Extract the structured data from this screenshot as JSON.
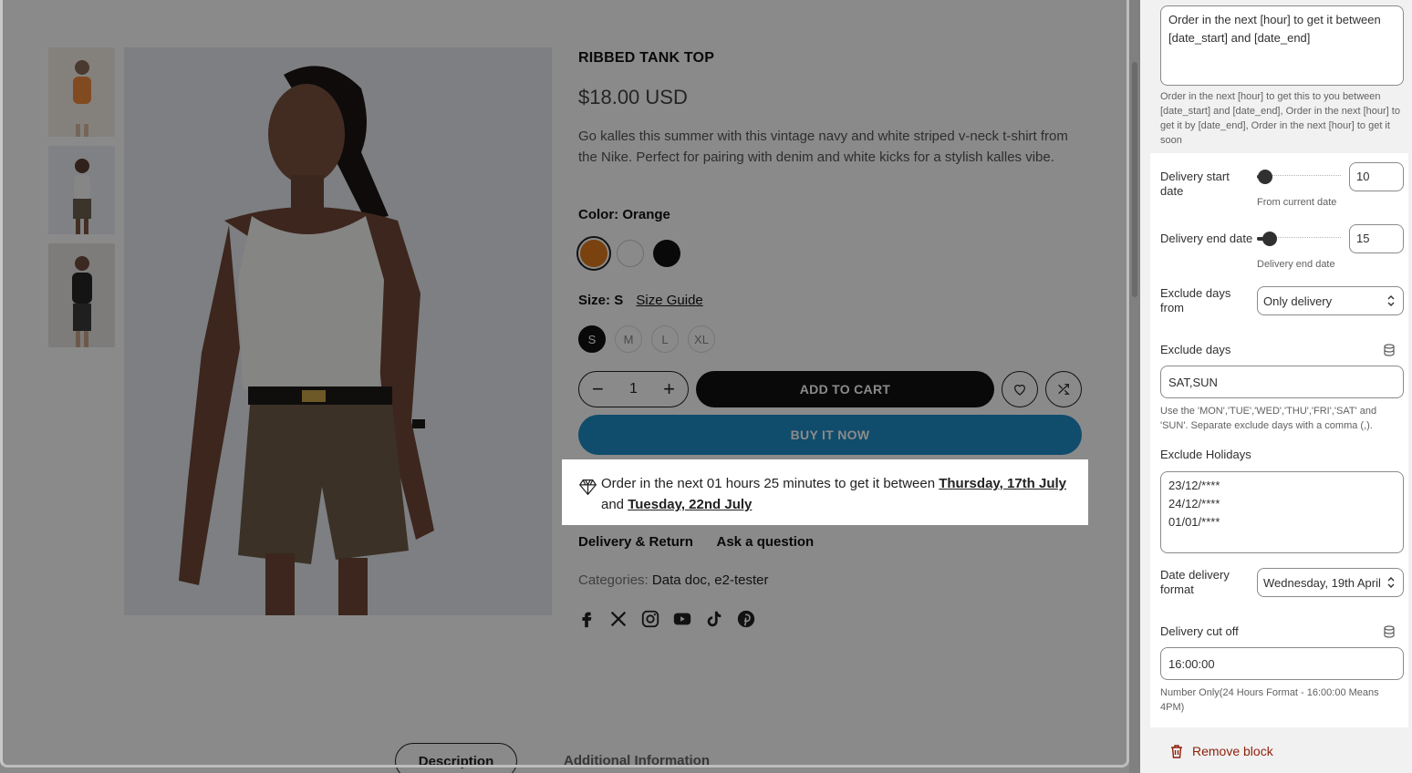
{
  "product": {
    "title": "RIBBED TANK TOP",
    "price": "$18.00 USD",
    "description": "Go kalles this summer with this vintage navy and white striped v-neck t-shirt from the Nike. Perfect for pairing with denim and white kicks for a stylish kalles vibe.",
    "color_label": "Color:",
    "color_value": "Orange",
    "colors": [
      "#e07b1c",
      "#ffffff",
      "#111111"
    ],
    "size_label": "Size:",
    "size_value": "S",
    "size_guide": "Size Guide",
    "sizes": [
      "S",
      "M",
      "L",
      "XL"
    ],
    "quantity": "1",
    "add_to_cart": "ADD TO CART",
    "buy_it_now": "BUY IT NOW",
    "delivery_msg_prefix": "Order in the next 01 hours 25 minutes to get it between",
    "delivery_start": "Thursday, 17th July",
    "delivery_and": "and",
    "delivery_end": "Tuesday, 22nd July",
    "tab_delivery": "Delivery & Return",
    "tab_question": "Ask a question",
    "categories_label": "Categories:",
    "categories_value": "Data doc, e2-tester",
    "social_icons": [
      "facebook-icon",
      "x-icon",
      "instagram-icon",
      "youtube-icon",
      "tiktok-icon",
      "pinterest-icon"
    ],
    "bottom_tabs": [
      "Description",
      "Additional Information"
    ]
  },
  "settings": {
    "message_template": "Order in the next [hour] to get it between [date_start] and [date_end]",
    "message_help": "Order in the next [hour] to get this to you between [date_start] and [date_end], Order in the next [hour] to get it by [date_end], Order in the next [hour] to get it soon",
    "delivery_start_label": "Delivery start date",
    "delivery_start_value": "10",
    "delivery_start_help": "From current date",
    "delivery_end_label": "Delivery end date",
    "delivery_end_value": "15",
    "delivery_end_help": "Delivery end date",
    "exclude_from_label": "Exclude days from",
    "exclude_from_value": "Only delivery",
    "exclude_days_label": "Exclude days",
    "exclude_days_value": "SAT,SUN",
    "exclude_days_help": "Use the 'MON','TUE','WED','THU','FRI','SAT' and 'SUN'. Separate exclude days with a comma (,).",
    "holidays_label": "Exclude Holidays",
    "holidays": [
      "23/12/****",
      "24/12/****",
      "01/01/****"
    ],
    "date_format_label": "Date delivery format",
    "date_format_value": "Wednesday, 19th April",
    "cutoff_label": "Delivery cut off",
    "cutoff_value": "16:00:00",
    "cutoff_help": "Number Only(24 Hours Format - 16:00:00 Means 4PM)",
    "remove_block": "Remove block"
  },
  "colors": {
    "buy_now": "#1f8cc7",
    "remove": "#8e1f0b"
  }
}
